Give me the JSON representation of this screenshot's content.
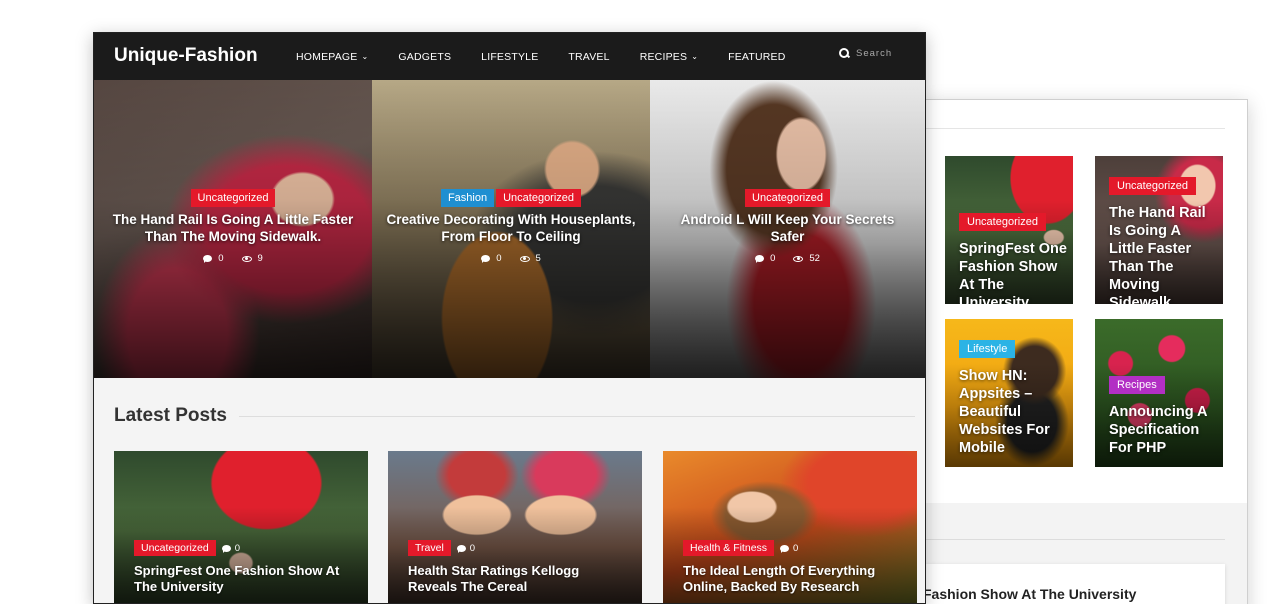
{
  "site": {
    "logo": "Unique-Fashion",
    "menu": [
      {
        "label": "HOMEPAGE",
        "has_dropdown": true
      },
      {
        "label": "GADGETS",
        "has_dropdown": false
      },
      {
        "label": "LIFESTYLE",
        "has_dropdown": false
      },
      {
        "label": "TRAVEL",
        "has_dropdown": false
      },
      {
        "label": "RECIPES",
        "has_dropdown": true
      },
      {
        "label": "FEATURED",
        "has_dropdown": false
      }
    ],
    "search_placeholder": "Search"
  },
  "hero": [
    {
      "categories": [
        "Uncategorized"
      ],
      "title": "The Hand Rail Is Going A Little Faster Than The Moving Sidewalk.",
      "comments": "0",
      "views": "9"
    },
    {
      "categories": [
        "Fashion",
        "Uncategorized"
      ],
      "title": "Creative Decorating With Houseplants, From Floor To Ceiling",
      "comments": "0",
      "views": "5"
    },
    {
      "categories": [
        "Uncategorized"
      ],
      "title": "Android L Will Keep Your Secrets Safer",
      "comments": "0",
      "views": "52"
    }
  ],
  "latest": {
    "heading": "Latest Posts",
    "posts": [
      {
        "category": "Uncategorized",
        "comments": "0",
        "title": "SpringFest One Fashion Show At The University"
      },
      {
        "category": "Travel",
        "comments": "0",
        "title": "Health Star Ratings Kellogg Reveals The Cereal"
      },
      {
        "category": "Health & Fitness",
        "comments": "0",
        "title": "The Ideal Length Of Everything Online, Backed By Research"
      }
    ]
  },
  "sidebar": {
    "tiles": [
      {
        "category": "Uncategorized",
        "title": "SpringFest One Fashion Show At The University"
      },
      {
        "category": "Uncategorized",
        "title": "The Hand Rail Is Going A Little Faster Than The Moving Sidewalk."
      },
      {
        "category": "Lifestyle",
        "title": "Show HN: Appsites – Beautiful Websites For Mobile"
      },
      {
        "category": "Recipes",
        "title": "Announcing A Specification For PHP"
      }
    ],
    "bottom_text": "Fashion Show At The University"
  },
  "colors": {
    "uncategorized": "#e4192a",
    "fashion": "#1f8fd1",
    "lifestyle": "#2bb3e5",
    "recipes": "#b22fc4",
    "nav_bg": "#1b1b1b"
  }
}
